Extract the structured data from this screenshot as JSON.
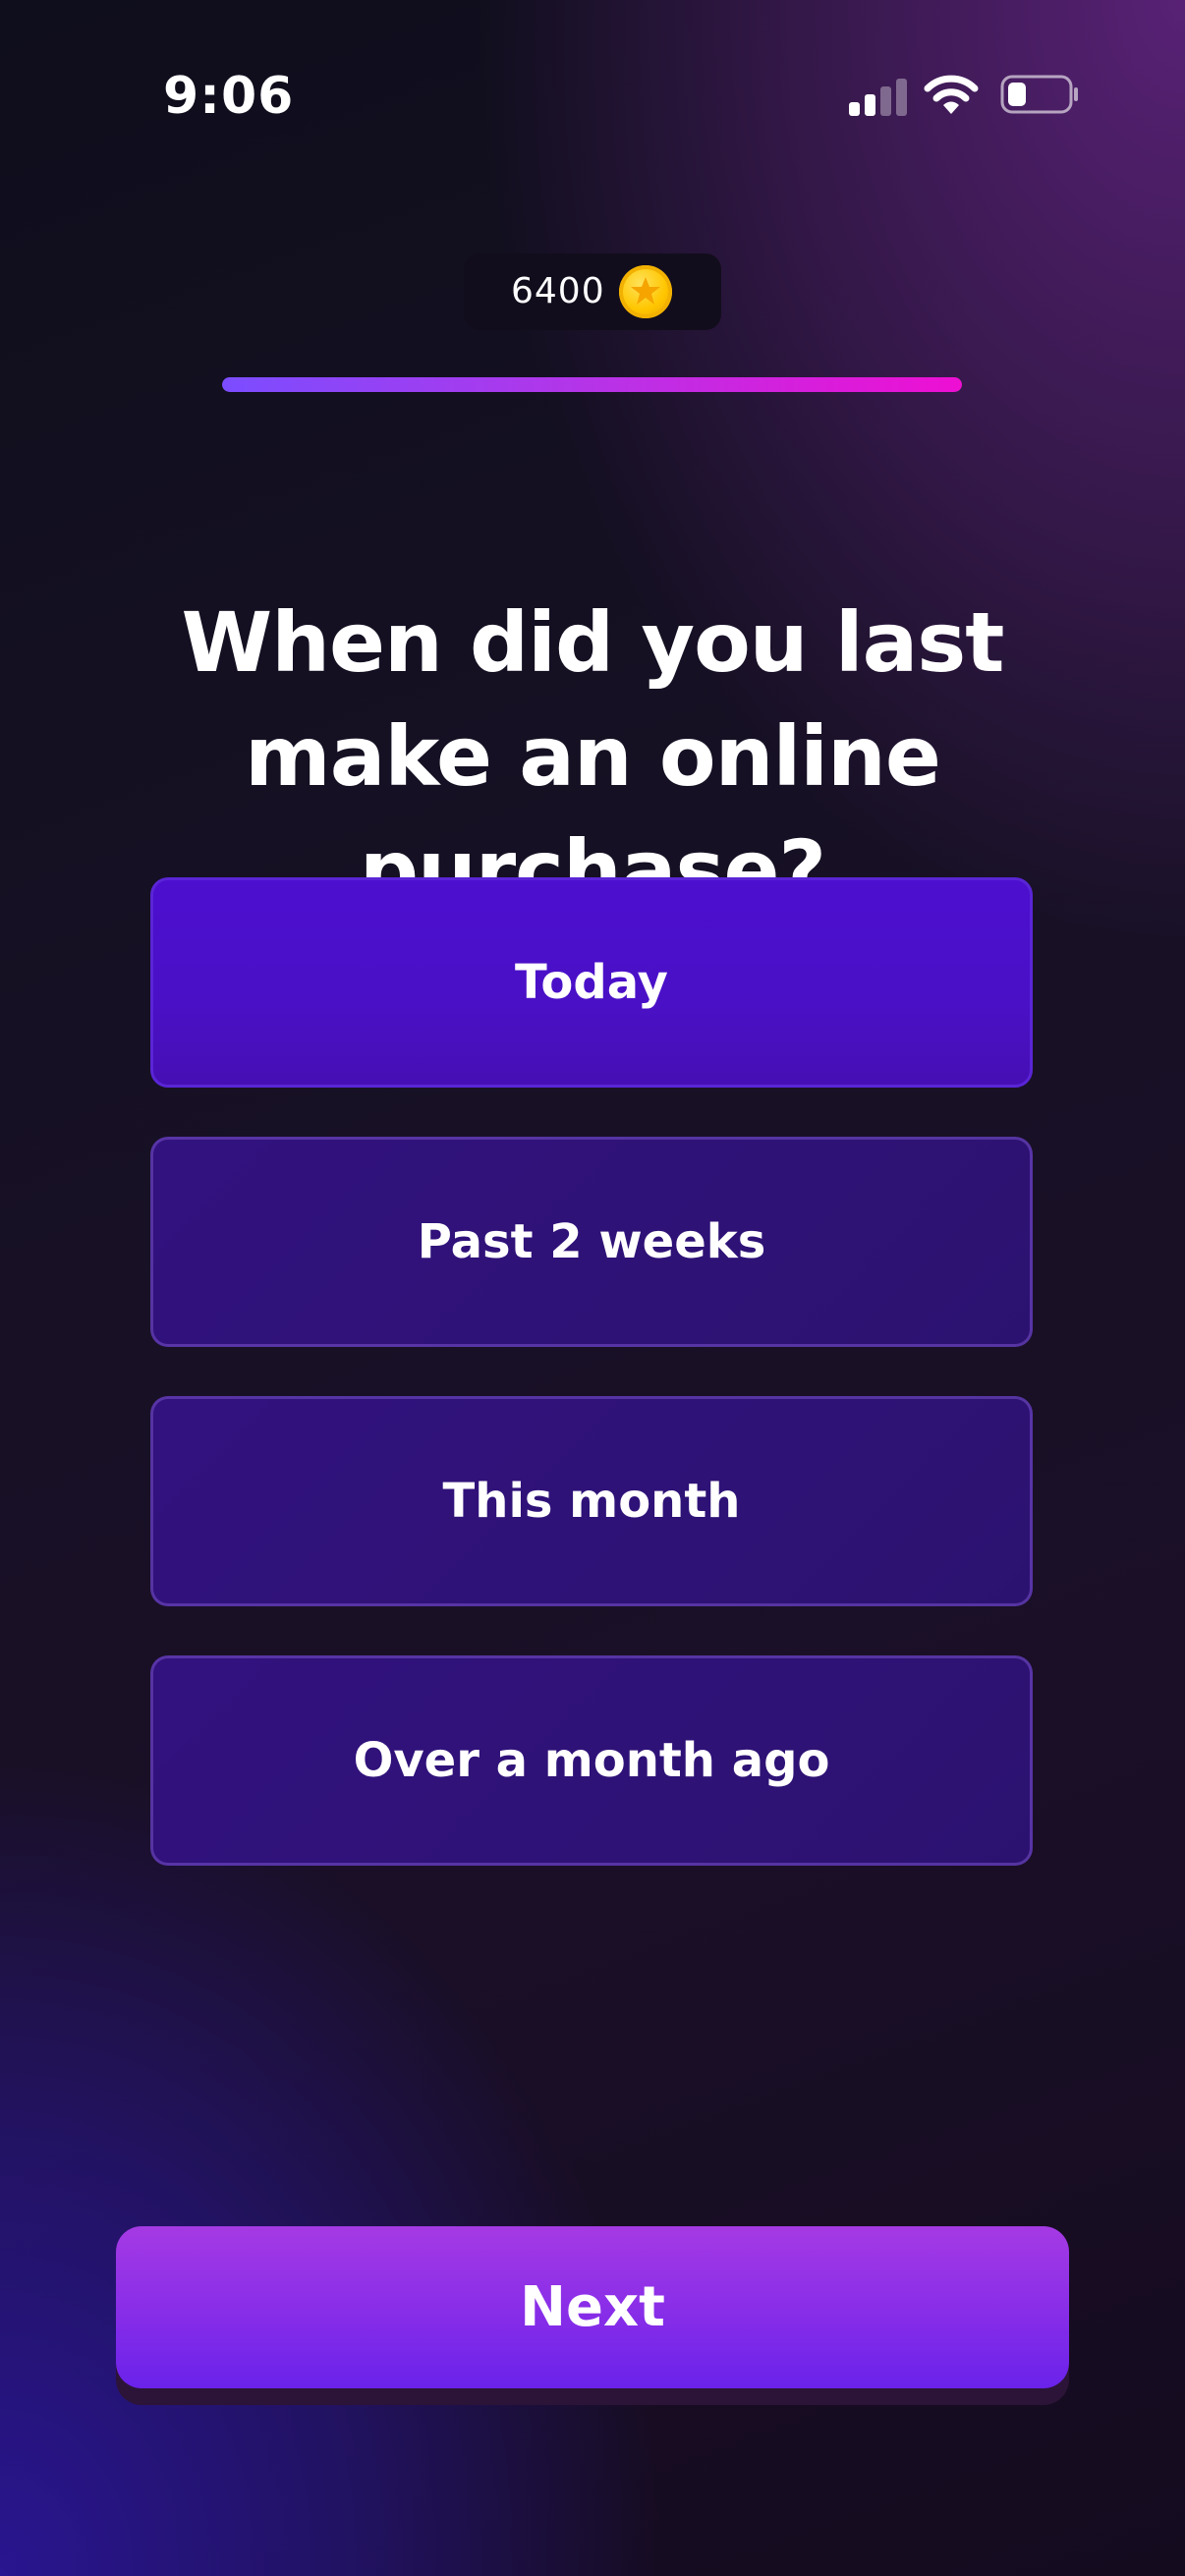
{
  "status_bar": {
    "time": "9:06"
  },
  "header": {
    "coin_balance": "6400",
    "coin_icon": "gold-star-coin-icon",
    "progress_fraction": 1.0
  },
  "question": {
    "text": "When did you last make an online purchase?"
  },
  "options": [
    {
      "label": "Today",
      "selected": true
    },
    {
      "label": "Past 2 weeks",
      "selected": false
    },
    {
      "label": "This month",
      "selected": false
    },
    {
      "label": "Over a month ago",
      "selected": false
    }
  ],
  "footer": {
    "next_label": "Next"
  },
  "colors": {
    "selected_option": "#4c0fcf",
    "unselected_option": "#32127f",
    "progress_start": "#7b4dff",
    "progress_end": "#ee0fd3",
    "next_button": "#8a2ee8",
    "coin": "#ffc600"
  }
}
